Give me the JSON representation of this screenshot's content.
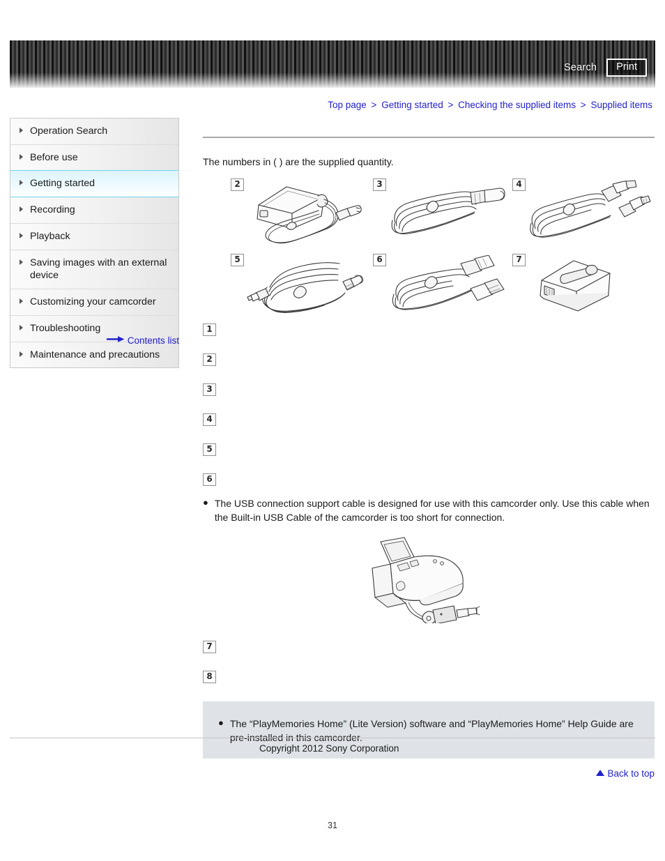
{
  "header": {
    "search_label": "Search",
    "print_label": "Print"
  },
  "breadcrumb": {
    "separator": ">",
    "items": [
      {
        "label": "Top page"
      },
      {
        "label": "Getting started"
      },
      {
        "label": "Checking the supplied items"
      },
      {
        "label": "Supplied items"
      }
    ]
  },
  "sidebar": {
    "items": [
      {
        "label": "Operation Search",
        "active": false
      },
      {
        "label": "Before use",
        "active": false
      },
      {
        "label": "Getting started",
        "active": true
      },
      {
        "label": "Recording",
        "active": false
      },
      {
        "label": "Playback",
        "active": false
      },
      {
        "label": "Saving images with an external device",
        "active": false
      },
      {
        "label": "Customizing your camcorder",
        "active": false
      },
      {
        "label": "Troubleshooting",
        "active": false
      },
      {
        "label": "Maintenance and precautions",
        "active": false
      }
    ],
    "contents_list_label": "Contents list"
  },
  "main": {
    "intro_text": "The numbers in ( ) are the supplied quantity.",
    "illustrations": [
      {
        "badge": "2",
        "icon": "ac-adaptor-icon"
      },
      {
        "badge": "3",
        "icon": "power-cord-icon"
      },
      {
        "badge": "4",
        "icon": "hdmi-cable-icon"
      },
      {
        "badge": "5",
        "icon": "av-cable-icon"
      },
      {
        "badge": "6",
        "icon": "usb-support-cable-icon"
      },
      {
        "badge": "7",
        "icon": "battery-pack-icon"
      }
    ],
    "item_list": [
      {
        "badge": "1",
        "label": ""
      },
      {
        "badge": "2",
        "label": ""
      },
      {
        "badge": "3",
        "label": ""
      },
      {
        "badge": "4",
        "label": ""
      },
      {
        "badge": "5",
        "label": ""
      },
      {
        "badge": "6",
        "label": ""
      }
    ],
    "usb_note": {
      "bullet": "●",
      "text": "The USB connection support cable is designed for use with this camcorder only. Use this cable when the Built-in USB Cable of the camcorder is too short for connection."
    },
    "camcorder_figure_icon": "camcorder-with-usb-cable-icon",
    "item_list_tail": [
      {
        "badge": "7",
        "label": ""
      },
      {
        "badge": "8",
        "label": ""
      }
    ],
    "note_box": {
      "bullet": "●",
      "text": "The “PlayMemories Home” (Lite Version) software and “PlayMemories Home” Help Guide are pre-installed in this camcorder."
    },
    "back_to_top_label": "Back to top"
  },
  "footer": {
    "copyright": "Copyright 2012 Sony Corporation",
    "page_number": "31"
  },
  "colors": {
    "link": "#2222cc",
    "active_nav": "#ddf4fb",
    "note_box_bg": "#dfe3e8"
  }
}
